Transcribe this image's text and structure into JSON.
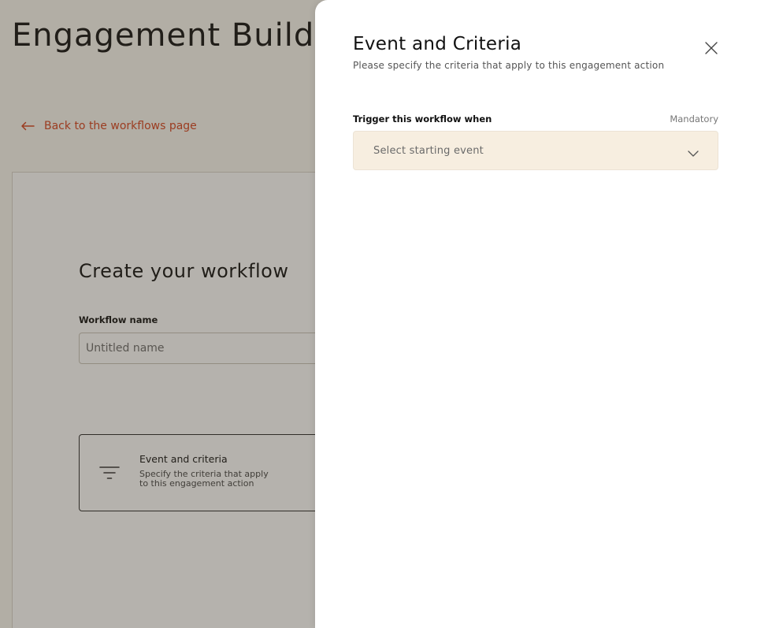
{
  "page": {
    "title": "Engagement Builder",
    "back_link": "Back to the workflows page",
    "create_title": "Create your workflow",
    "workflow_name_label": "Workflow name",
    "workflow_name_placeholder": "Untitled name",
    "step_card": {
      "title": "Event and criteria",
      "description": "Specify the criteria that apply to this engagement action",
      "icon": "filter-icon"
    }
  },
  "panel": {
    "title": "Event and Criteria",
    "subtitle": "Please specify the criteria that apply to this engagement action",
    "close_icon": "close-icon",
    "field": {
      "label": "Trigger this workflow when",
      "hint": "Mandatory",
      "placeholder": "Select starting event",
      "icon": "chevron-down-icon"
    }
  },
  "colors": {
    "accent": "#d6431e",
    "select_bg": "#f7eee0",
    "overlay": "rgba(60,52,40,0.38)"
  }
}
